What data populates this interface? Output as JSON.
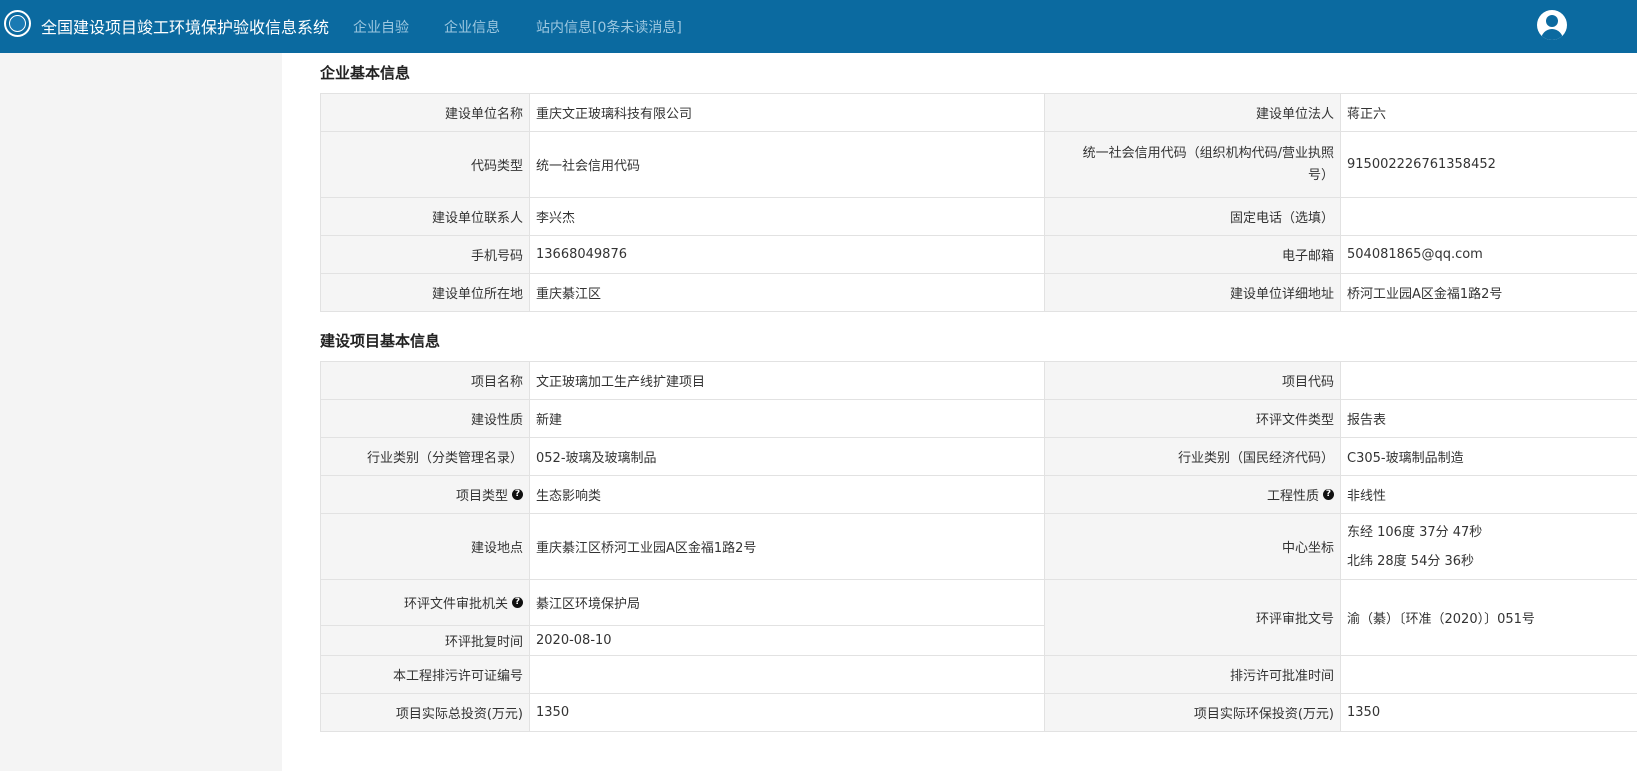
{
  "header": {
    "app_title": "全国建设项目竣工环境保护验收信息系统",
    "nav": [
      "企业自验",
      "企业信息",
      "站内信息[0条未读消息]"
    ]
  },
  "company": {
    "section_title": "企业基本信息",
    "rows": [
      {
        "l1": "建设单位名称",
        "v1": "重庆文正玻璃科技有限公司",
        "l2": "建设单位法人",
        "v2": "蒋正六"
      },
      {
        "l1": "代码类型",
        "v1": "统一社会信用代码",
        "l2": "统一社会信用代码（组织机构代码/营业执照号）",
        "v2": "915002226761358452"
      },
      {
        "l1": "建设单位联系人",
        "v1": "李兴杰",
        "l2": "固定电话（选填）",
        "v2": ""
      },
      {
        "l1": "手机号码",
        "v1": "13668049876",
        "l2": "电子邮箱",
        "v2": "504081865@qq.com"
      },
      {
        "l1": "建设单位所在地",
        "v1": "重庆綦江区",
        "l2": "建设单位详细地址",
        "v2": "桥河工业园A区金福1路2号"
      }
    ]
  },
  "project": {
    "section_title": "建设项目基本信息",
    "rows": [
      {
        "l1": "项目名称",
        "v1": "文正玻璃加工生产线扩建项目",
        "l2": "项目代码",
        "v2": ""
      },
      {
        "l1": "建设性质",
        "v1": "新建",
        "l2": "环评文件类型",
        "v2": "报告表"
      },
      {
        "l1": "行业类别（分类管理名录）",
        "v1": "052-玻璃及玻璃制品",
        "l2": "行业类别（国民经济代码）",
        "v2": "C305-玻璃制品制造"
      },
      {
        "l1": "项目类型",
        "v1": "生态影响类",
        "l2": "工程性质",
        "v2": "非线性"
      },
      {
        "l1": "建设地点",
        "v1": "重庆綦江区桥河工业园A区金福1路2号",
        "l2": "中心坐标",
        "v2a": "东经 106度 37分 47秒",
        "v2b": "北纬 28度 54分 36秒"
      },
      {
        "l1": "环评文件审批机关",
        "v1": "綦江区环境保护局",
        "l1b": "环评批复时间",
        "v1b": "2020-08-10",
        "l2": "环评审批文号",
        "v2": "渝（綦）〔环准（2020）〕051号"
      },
      {
        "l1": "本工程排污许可证编号",
        "v1": "",
        "l2": "排污许可批准时间",
        "v2": ""
      },
      {
        "l1": "项目实际总投资(万元)",
        "v1": "1350",
        "l2": "项目实际环保投资(万元)",
        "v2": "1350"
      }
    ]
  }
}
